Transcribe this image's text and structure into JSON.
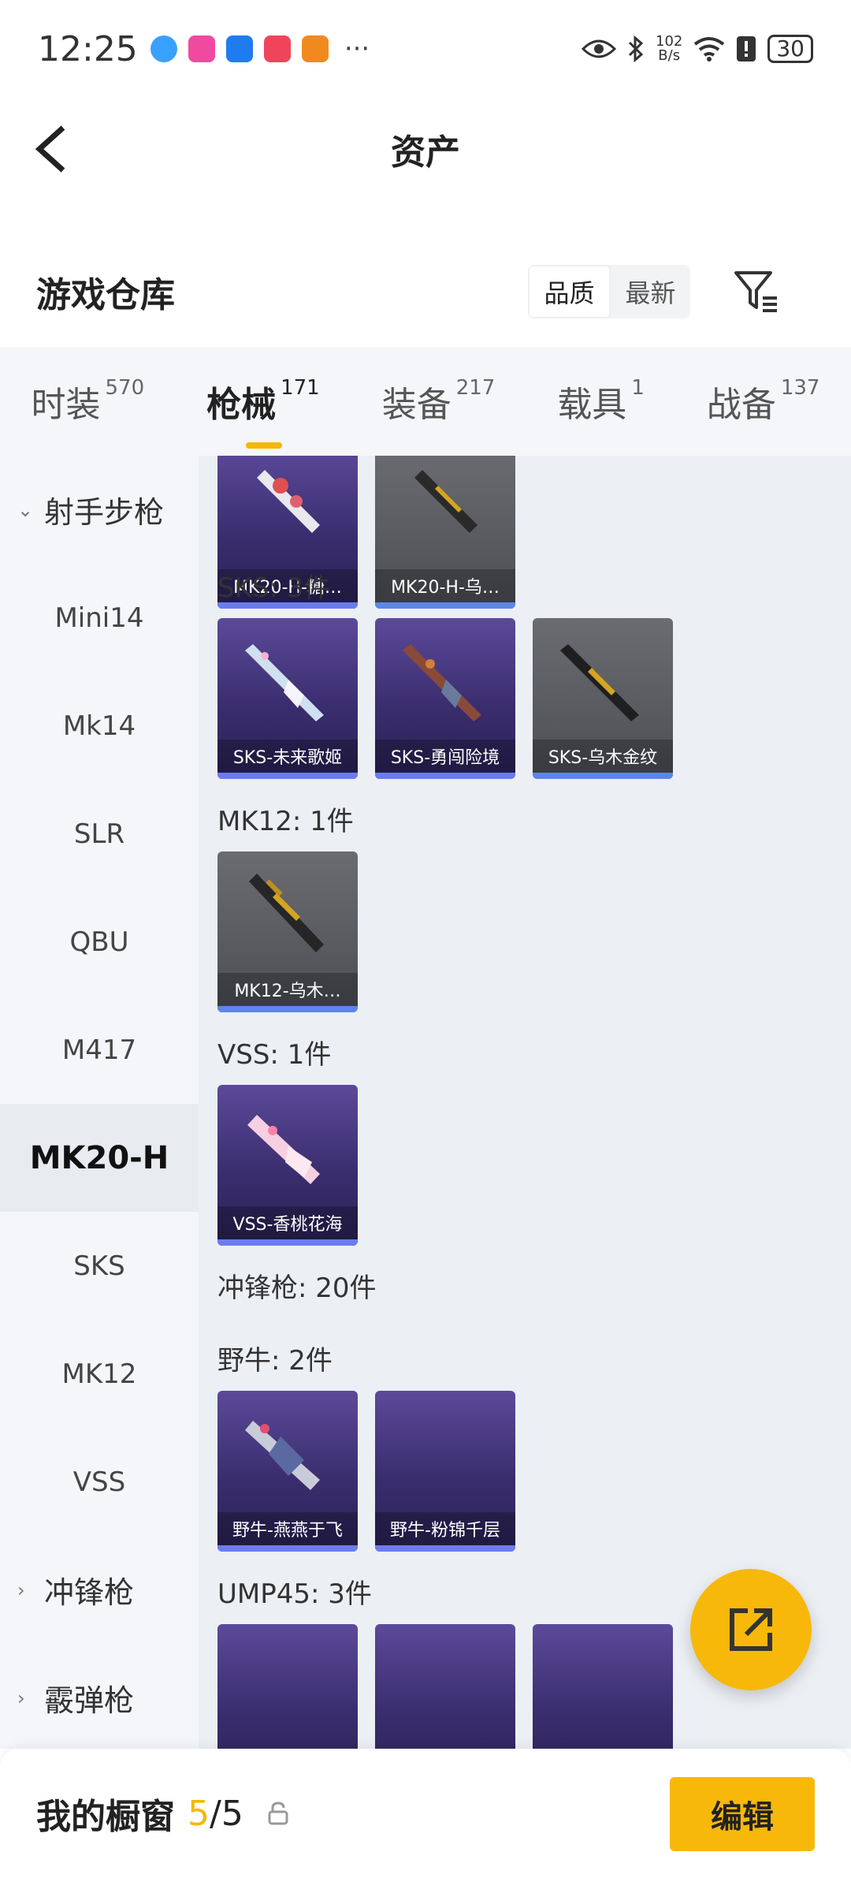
{
  "status_bar": {
    "time": "12:25",
    "net_speed_value": "102",
    "net_speed_unit": "B/s",
    "battery": "30",
    "more": "···",
    "app_icon_colors": [
      "#3aa0ff",
      "#f04aa0",
      "#1e7cf0",
      "#f0445a",
      "#f08a1e"
    ]
  },
  "header": {
    "title": "资产"
  },
  "warehouse": {
    "title": "游戏仓库",
    "sort_options": [
      "品质",
      "最新"
    ],
    "sort_selected": "品质"
  },
  "tabs": [
    {
      "label": "时装",
      "count": "570"
    },
    {
      "label": "枪械",
      "count": "171",
      "active": true
    },
    {
      "label": "装备",
      "count": "217"
    },
    {
      "label": "载具",
      "count": "1"
    },
    {
      "label": "战备",
      "count": "137"
    }
  ],
  "sidebar": {
    "items": [
      {
        "label": "射手步枪",
        "type": "group",
        "expanded": true
      },
      {
        "label": "Mini14"
      },
      {
        "label": "Mk14"
      },
      {
        "label": "SLR"
      },
      {
        "label": "QBU"
      },
      {
        "label": "M417"
      },
      {
        "label": "MK20-H",
        "selected": true
      },
      {
        "label": "SKS"
      },
      {
        "label": "MK12"
      },
      {
        "label": "VSS"
      },
      {
        "label": "冲锋枪",
        "type": "group",
        "expanded": false
      },
      {
        "label": "霰弹枪",
        "type": "group",
        "expanded": false
      }
    ]
  },
  "content": {
    "mk20_cards": [
      "MK20-H-糖…",
      "MK20-H-乌…"
    ],
    "sks_title": "SKS: 3件",
    "sks_cards": [
      "SKS-未来歌姬",
      "SKS-勇闯险境",
      "SKS-乌木金纹"
    ],
    "mk12_title": "MK12: 1件",
    "mk12_cards": [
      "MK12-乌木…"
    ],
    "vss_title": "VSS: 1件",
    "vss_cards": [
      "VSS-香桃花海"
    ],
    "smg_title": "冲锋枪: 20件",
    "bison_title": "野牛: 2件",
    "bison_cards": [
      "野牛-燕燕于飞",
      "野牛-粉锦千层"
    ],
    "ump_title": "UMP45: 3件"
  },
  "bottom": {
    "showcase_label": "我的橱窗",
    "used": "5",
    "separator": "/",
    "total": "5",
    "edit_label": "编辑"
  },
  "colors": {
    "accent": "#f8b80a",
    "rare_bar": "#6b7cf0"
  }
}
